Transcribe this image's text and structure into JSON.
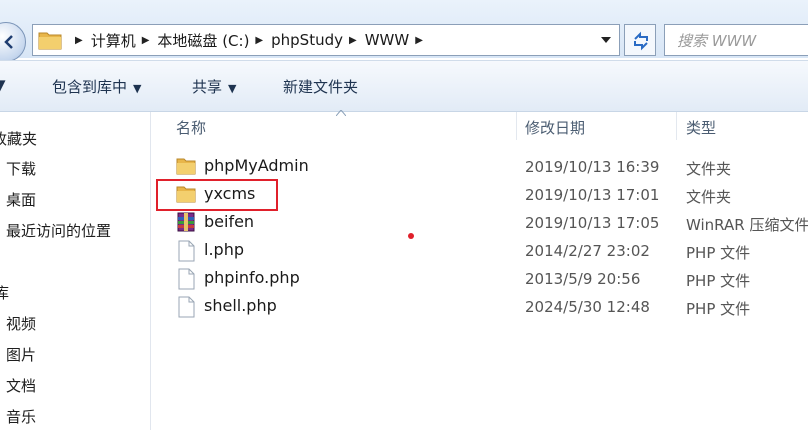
{
  "address": {
    "crumbs": [
      "计算机",
      "本地磁盘 (C:)",
      "phpStudy",
      "WWW"
    ]
  },
  "search": {
    "placeholder": "搜索 WWW"
  },
  "toolbar": {
    "include_in_library": "包含到库中",
    "share": "共享",
    "new_folder": "新建文件夹"
  },
  "nav": {
    "favorites_header": "收藏夹",
    "downloads": "下载",
    "desktop": "桌面",
    "recent_places": "最近访问的位置",
    "libraries_header": "库",
    "videos": "视频",
    "pictures": "图片",
    "documents": "文档",
    "music": "音乐"
  },
  "columns": {
    "name": "名称",
    "date": "修改日期",
    "type": "类型"
  },
  "files": [
    {
      "name": "phpMyAdmin",
      "date": "2019/10/13 16:39",
      "type": "文件夹",
      "icon": "folder-icon"
    },
    {
      "name": "yxcms",
      "date": "2019/10/13 17:01",
      "type": "文件夹",
      "icon": "folder-icon"
    },
    {
      "name": "beifen",
      "date": "2019/10/13 17:05",
      "type": "WinRAR 压缩文件",
      "icon": "winrar-archive-icon"
    },
    {
      "name": "l.php",
      "date": "2014/2/27 23:02",
      "type": "PHP 文件",
      "icon": "php-file-icon"
    },
    {
      "name": "phpinfo.php",
      "date": "2013/5/9 20:56",
      "type": "PHP 文件",
      "icon": "php-file-icon"
    },
    {
      "name": "shell.php",
      "date": "2024/5/30 12:48",
      "type": "PHP 文件",
      "icon": "php-file-icon"
    }
  ],
  "colors": {
    "highlight": "#e0202b",
    "folder": "#e8b64a",
    "chrome": "#d8e6f6"
  }
}
